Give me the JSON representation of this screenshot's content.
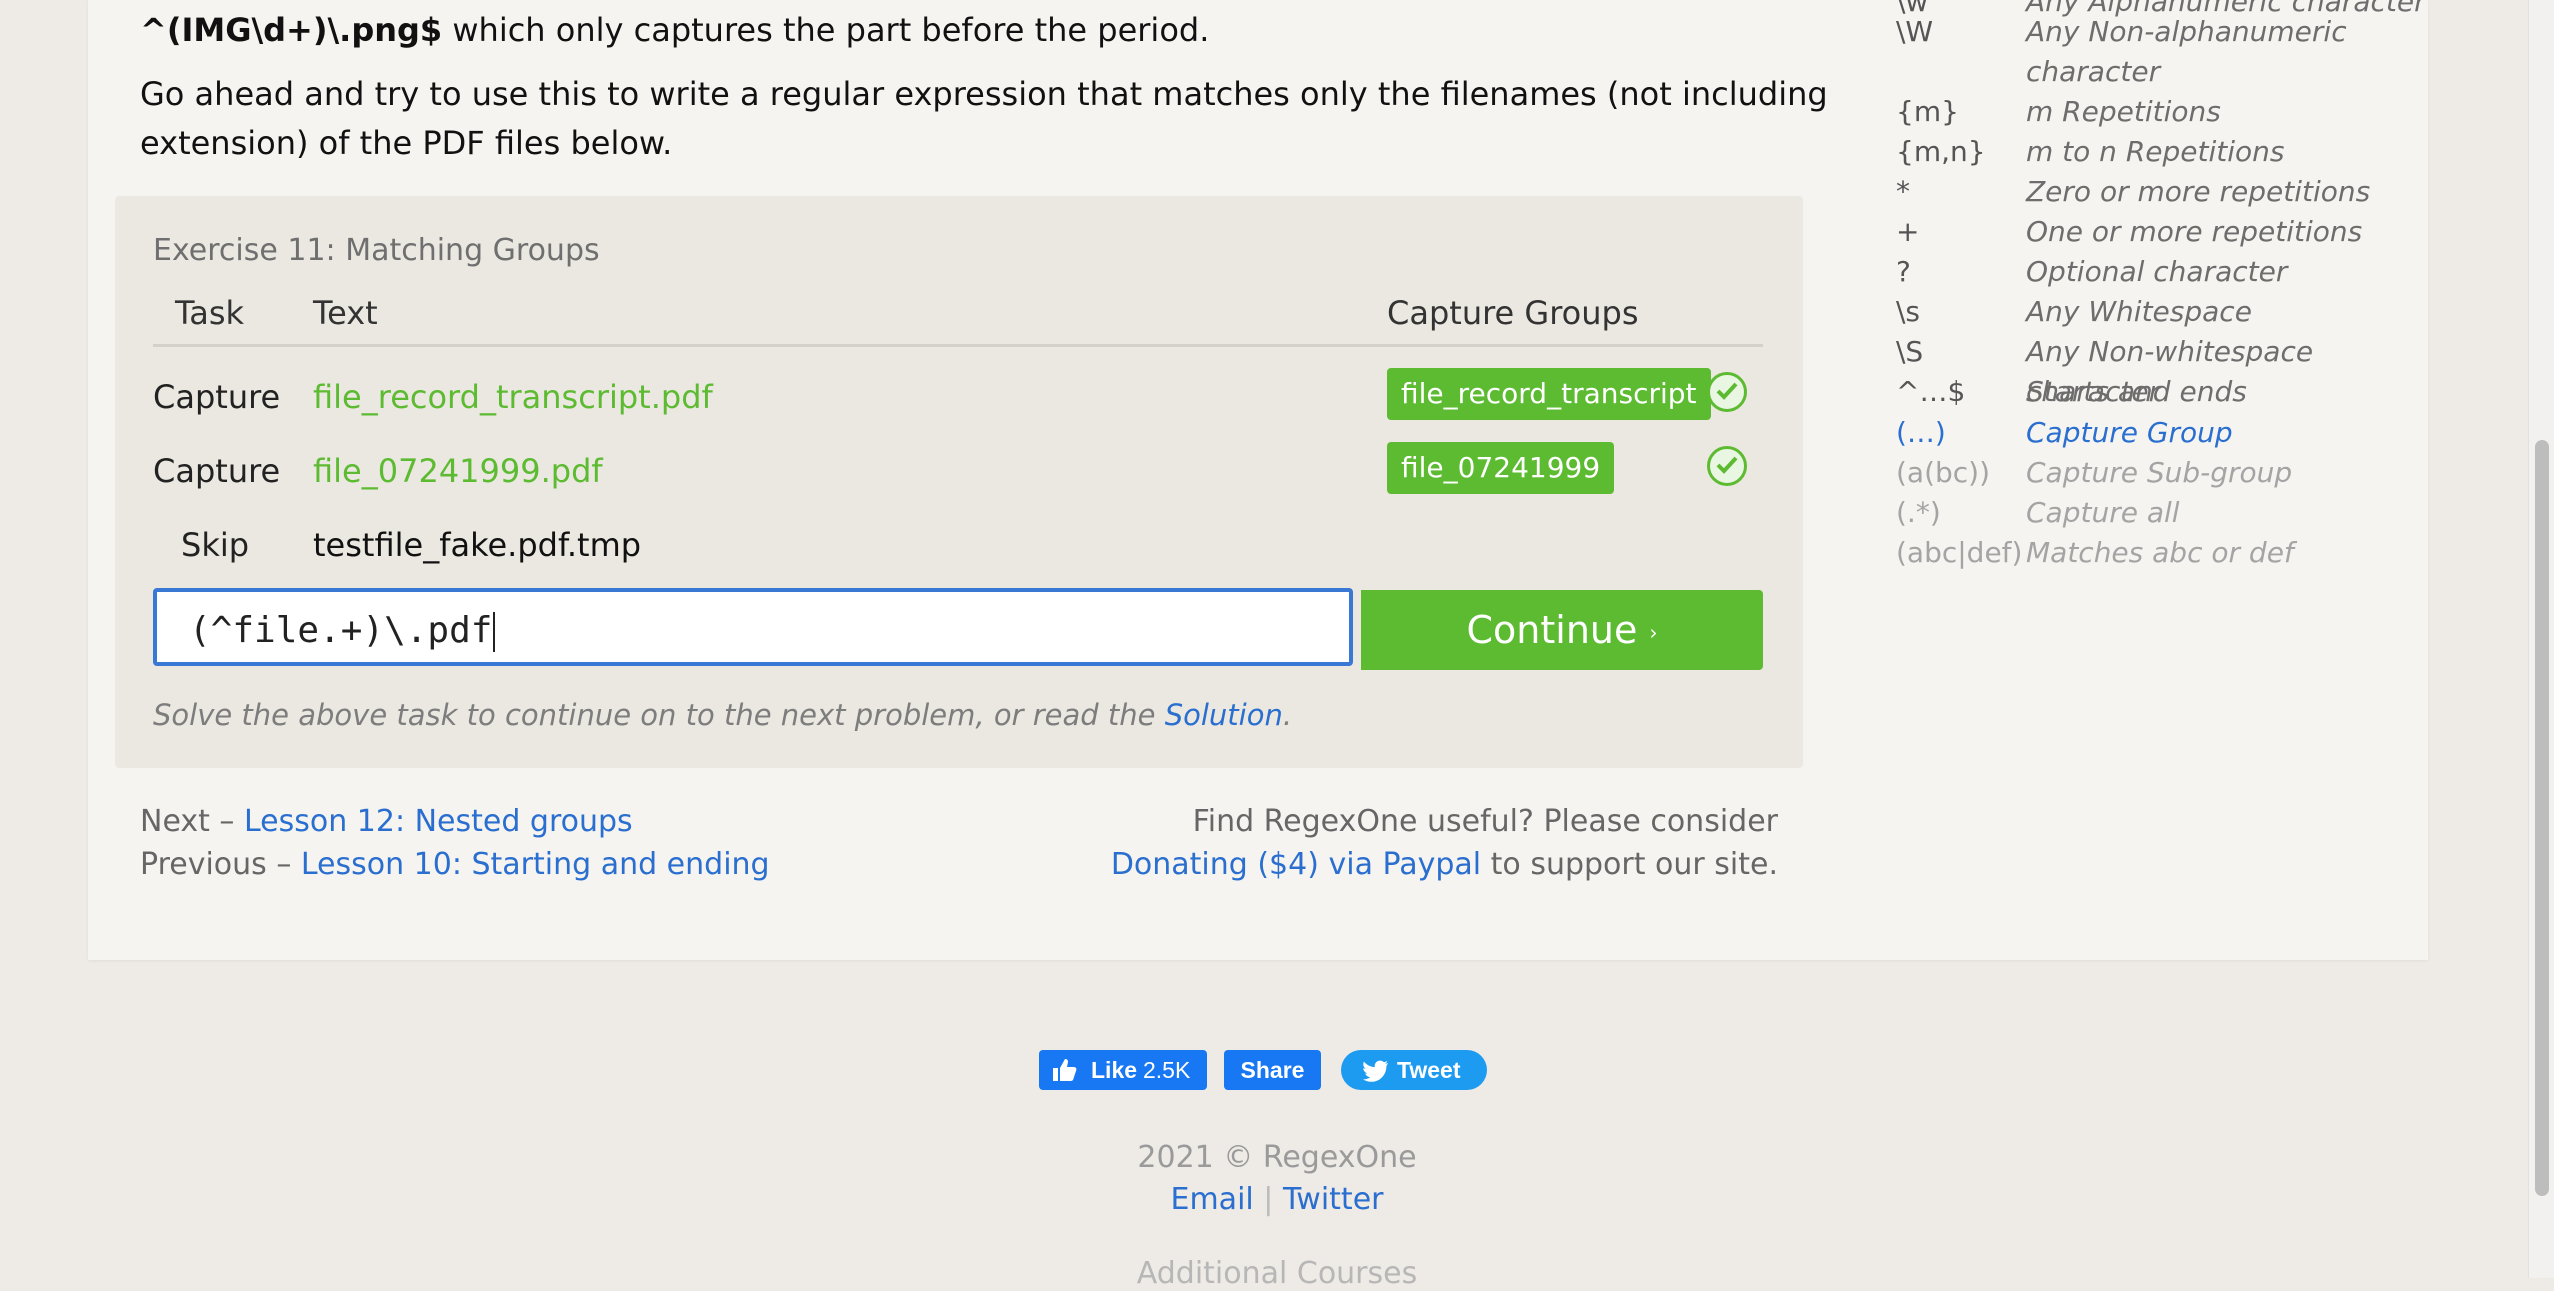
{
  "intro": {
    "code": "^(IMG\\d+)\\.png$",
    "line1_rest": " which only captures the part before the period.",
    "line2": "Go ahead and try to use this to write a regular expression that matches only the filenames (not including extension) of the PDF files below."
  },
  "exercise": {
    "title": "Exercise 11: Matching Groups",
    "headers": {
      "task": "Task",
      "text": "Text",
      "groups": "Capture Groups"
    },
    "rows": [
      {
        "task": "Capture",
        "text": "file_record_transcript.pdf",
        "group": "file_record_transcript",
        "status": "check-icon"
      },
      {
        "task": "Capture",
        "text": "file_07241999.pdf",
        "group": "file_07241999",
        "status": "check-icon"
      },
      {
        "task": "Skip",
        "text": "testfile_fake.pdf.tmp"
      }
    ],
    "answer": "(^file.+)\\.pdf",
    "continue": "Continue",
    "continue_arrow": "›",
    "hint_text": "Solve the above task to continue on to the next problem, or read the ",
    "hint_link": "Solution",
    "hint_end": "."
  },
  "nav": {
    "next_prefix": "Next – ",
    "next_link": "Lesson 12: Nested groups",
    "prev_prefix": "Previous – ",
    "prev_link": "Lesson 10: Starting and ending",
    "donate_line1": "Find RegexOne useful? Please consider",
    "donate_link": "Donating ($4) via Paypal",
    "donate_rest": " to support our site."
  },
  "sidebar": [
    {
      "k": "\\w",
      "v": "Any Alphanumeric character"
    },
    {
      "k": "\\W",
      "v": "Any Non-alphanumeric",
      "v2": "character"
    },
    {
      "k": "{m}",
      "v": "m Repetitions"
    },
    {
      "k": "{m,n}",
      "v": "m to n Repetitions"
    },
    {
      "k": "*",
      "v": "Zero or more repetitions"
    },
    {
      "k": "+",
      "v": "One or more repetitions"
    },
    {
      "k": "?",
      "v": "Optional character"
    },
    {
      "k": "\\s",
      "v": "Any Whitespace"
    },
    {
      "k": "\\S",
      "v": "Any Non-whitespace character"
    },
    {
      "k": "^…$",
      "v": "Starts and ends"
    },
    {
      "k": "(…)",
      "v": "Capture Group"
    },
    {
      "k": "(a(bc))",
      "v": "Capture Sub-group"
    },
    {
      "k": "(.*)",
      "v": "Capture all"
    },
    {
      "k": "(abc|def)",
      "v": "Matches abc or def"
    }
  ],
  "social": {
    "like": "Like",
    "like_count": "2.5K",
    "share": "Share",
    "tweet": "Tweet"
  },
  "footer": {
    "copyright": "2021 © RegexOne",
    "email": "Email",
    "separator": "|",
    "twitter": "Twitter",
    "more": "Additional Courses"
  },
  "colors": {
    "accent": "#5dbb32",
    "link": "#2a6fcf",
    "focus": "#3a78d6"
  }
}
